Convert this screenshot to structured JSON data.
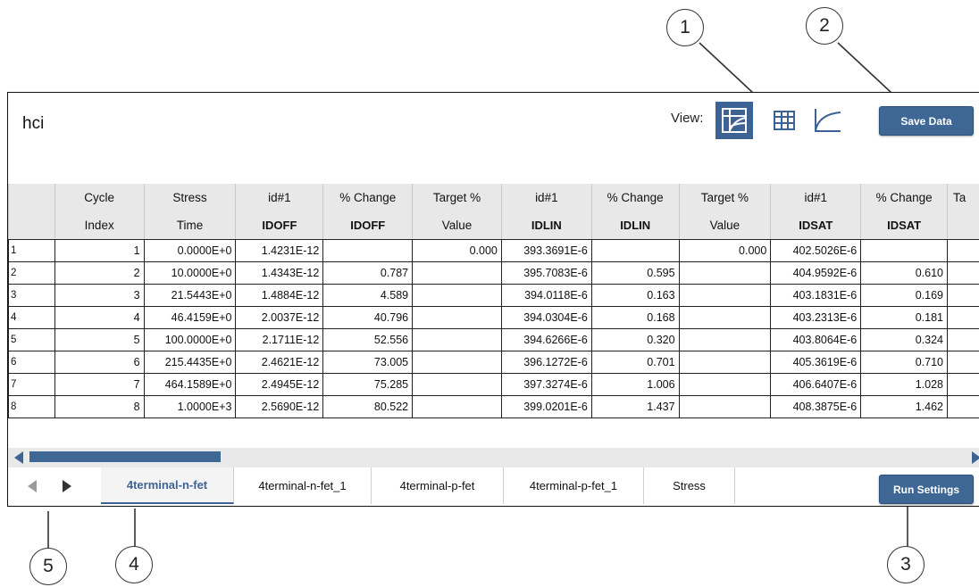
{
  "callouts": [
    "1",
    "2",
    "3",
    "4",
    "5"
  ],
  "header": {
    "title": "hci",
    "view_label": "View:",
    "view_icons": [
      "data-sheet-icon",
      "table-icon",
      "graph-icon"
    ],
    "save_label": "Save Data"
  },
  "table": {
    "header_row1": [
      "",
      "Cycle",
      "Stress",
      "id#1",
      "% Change",
      "Target %",
      "id#1",
      "% Change",
      "Target %",
      "id#1",
      "% Change",
      "Ta"
    ],
    "header_row2": [
      "",
      "Index",
      "Time",
      "IDOFF",
      "IDOFF",
      "Value",
      "IDLIN",
      "IDLIN",
      "Value",
      "IDSAT",
      "IDSAT",
      "V"
    ],
    "rows": [
      [
        "1",
        "1",
        "0.0000E+0",
        "1.4231E-12",
        "",
        "0.000",
        "393.3691E-6",
        "",
        "0.000",
        "402.5026E-6",
        "",
        ""
      ],
      [
        "2",
        "2",
        "10.0000E+0",
        "1.4343E-12",
        "0.787",
        "",
        "395.7083E-6",
        "0.595",
        "",
        "404.9592E-6",
        "0.610",
        ""
      ],
      [
        "3",
        "3",
        "21.5443E+0",
        "1.4884E-12",
        "4.589",
        "",
        "394.0118E-6",
        "0.163",
        "",
        "403.1831E-6",
        "0.169",
        ""
      ],
      [
        "4",
        "4",
        "46.4159E+0",
        "2.0037E-12",
        "40.796",
        "",
        "394.0304E-6",
        "0.168",
        "",
        "403.2313E-6",
        "0.181",
        ""
      ],
      [
        "5",
        "5",
        "100.0000E+0",
        "2.1711E-12",
        "52.556",
        "",
        "394.6266E-6",
        "0.320",
        "",
        "403.8064E-6",
        "0.324",
        ""
      ],
      [
        "6",
        "6",
        "215.4435E+0",
        "2.4621E-12",
        "73.005",
        "",
        "396.1272E-6",
        "0.701",
        "",
        "405.3619E-6",
        "0.710",
        ""
      ],
      [
        "7",
        "7",
        "464.1589E+0",
        "2.4945E-12",
        "75.285",
        "",
        "397.3274E-6",
        "1.006",
        "",
        "406.6407E-6",
        "1.028",
        ""
      ],
      [
        "8",
        "8",
        "1.0000E+3",
        "2.5690E-12",
        "80.522",
        "",
        "399.0201E-6",
        "1.437",
        "",
        "408.3875E-6",
        "1.462",
        ""
      ]
    ]
  },
  "tabs": [
    "4terminal-n-fet",
    "4terminal-n-fet_1",
    "4terminal-p-fet",
    "4terminal-p-fet_1",
    "Stress"
  ],
  "active_tab": "4terminal-n-fet",
  "run_settings_label": "Run Settings",
  "colors": {
    "accent": "#3f6796",
    "header_bg": "#e8e8e8",
    "scrollbar_track": "#e9e9e9"
  }
}
